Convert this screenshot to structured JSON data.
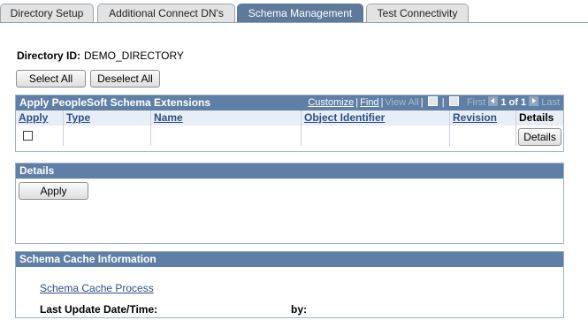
{
  "tabs": [
    {
      "label": "Directory Setup"
    },
    {
      "label": "Additional Connect DN's"
    },
    {
      "label": "Schema Management"
    },
    {
      "label": "Test Connectivity"
    }
  ],
  "directory": {
    "label": "Directory ID:",
    "value": "DEMO_DIRECTORY"
  },
  "buttons": {
    "select_all": "Select All",
    "deselect_all": "Deselect All",
    "apply": "Apply",
    "details": "Details"
  },
  "grid": {
    "title": "Apply PeopleSoft Schema Extensions",
    "nav": {
      "customize": "Customize",
      "find": "Find",
      "view_all": "View All",
      "first": "First",
      "range": "1 of 1",
      "last": "Last"
    },
    "columns": [
      "Apply",
      "Type",
      "Name",
      "Object Identifier",
      "Revision",
      "Details"
    ]
  },
  "details_section": {
    "title": "Details"
  },
  "cache_section": {
    "title": "Schema Cache Information",
    "process_link": "Schema Cache Process",
    "last_update_label": "Last Update Date/Time:",
    "by_label": "by:"
  },
  "colors": {
    "header": "#5f7fa6",
    "active_tab": "#5d7a9c",
    "link": "#2b4f88"
  }
}
